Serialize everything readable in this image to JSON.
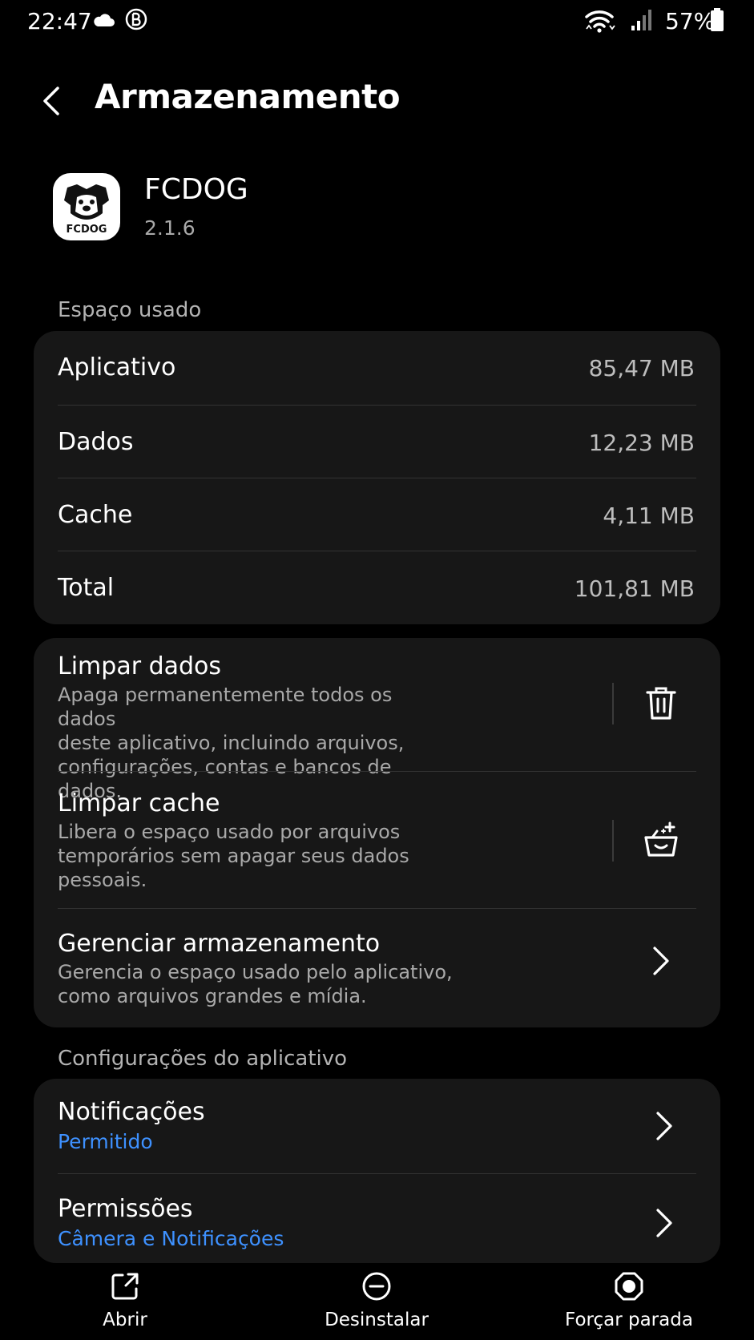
{
  "status_bar": {
    "time": "22:47",
    "battery": "57%",
    "icons": [
      "cloud-icon",
      "bixby-icon",
      "wifi-icon",
      "signal-icon",
      "battery-icon"
    ]
  },
  "header": {
    "title": "Armazenamento"
  },
  "app": {
    "name": "FCDOG",
    "version": "2.1.6",
    "icon_label": "FCDOG"
  },
  "space_used": {
    "label": "Espaço usado",
    "rows": [
      {
        "label": "Aplicativo",
        "value": "85,47 MB"
      },
      {
        "label": "Dados",
        "value": "12,23 MB"
      },
      {
        "label": "Cache",
        "value": "4,11 MB"
      },
      {
        "label": "Total",
        "value": "101,81 MB"
      }
    ]
  },
  "actions": {
    "clear_data": {
      "title": "Limpar dados",
      "desc_lines": [
        "Apaga permanentemente todos os dados",
        "deste aplicativo, incluindo arquivos,",
        "configurações, contas e bancos de dados."
      ]
    },
    "clear_cache": {
      "title": "Limpar cache",
      "desc_lines": [
        "Libera o espaço usado por arquivos",
        "temporários sem apagar seus dados",
        "pessoais."
      ]
    },
    "manage": {
      "title": "Gerenciar armazenamento",
      "desc_lines": [
        "Gerencia o espaço usado pelo aplicativo,",
        "como arquivos grandes e mídia."
      ]
    }
  },
  "app_settings": {
    "label": "Configurações do aplicativo",
    "notifications": {
      "title": "Notificações",
      "value": "Permitido"
    },
    "permissions": {
      "title": "Permissões",
      "value": "Câmera e Notificações"
    }
  },
  "bottom_bar": {
    "open": "Abrir",
    "uninstall": "Desinstalar",
    "force_stop": "Forçar parada"
  },
  "colors": {
    "background": "#000000",
    "card": "#171717",
    "accent": "#3e91ff",
    "secondary_text": "#a9a9a9"
  }
}
